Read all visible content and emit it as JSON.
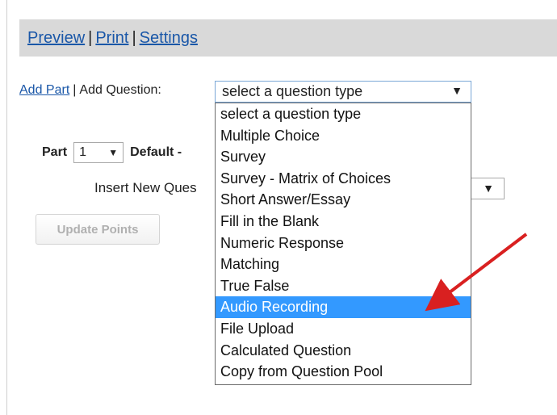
{
  "toolbar": {
    "links": [
      "Preview",
      "Print",
      "Settings"
    ],
    "separator": "|"
  },
  "add": {
    "add_part_label": "Add Part",
    "separator": "|",
    "add_question_label": "Add Question:"
  },
  "question_type_select": {
    "selected": "select a question type",
    "options": [
      "select a question type",
      "Multiple Choice",
      "Survey",
      "Survey - Matrix of Choices",
      "Short Answer/Essay",
      "Fill in the Blank",
      "Numeric Response",
      "Matching",
      "True False",
      "Audio Recording",
      "File Upload",
      "Calculated Question",
      "Copy from Question Pool"
    ],
    "highlighted": "Audio Recording"
  },
  "part": {
    "label": "Part",
    "number": "1",
    "title_fragment": "Default -"
  },
  "insert": {
    "label": "Insert New Ques"
  },
  "update_points_label": "Update Points",
  "colors": {
    "link": "#1a57a8",
    "highlight": "#3399ff",
    "toolbar_bg": "#d9d9d9",
    "annotation_arrow": "#d92020"
  }
}
